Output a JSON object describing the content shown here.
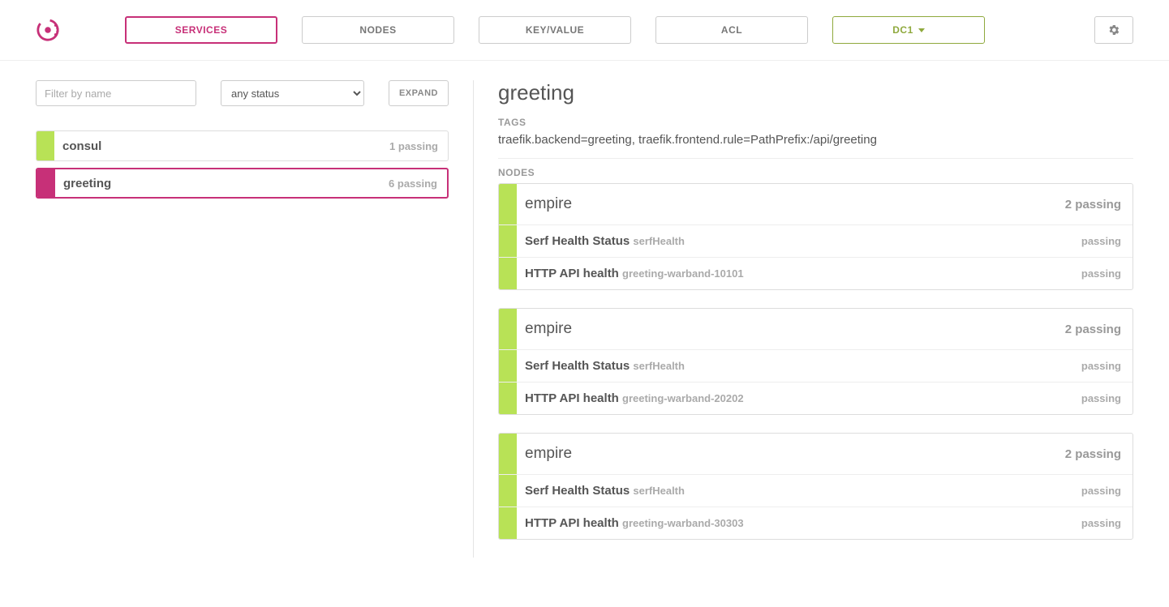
{
  "nav": {
    "services": "SERVICES",
    "nodes": "NODES",
    "kv": "KEY/VALUE",
    "acl": "ACL",
    "dc": "DC1"
  },
  "left": {
    "filter_placeholder": "Filter by name",
    "status_option": "any status",
    "expand": "EXPAND",
    "services": [
      {
        "name": "consul",
        "count": "1 passing",
        "selected": false
      },
      {
        "name": "greeting",
        "count": "6 passing",
        "selected": true
      }
    ]
  },
  "right": {
    "title": "greeting",
    "tags_label": "TAGS",
    "tags_value": "traefik.backend=greeting, traefik.frontend.rule=PathPrefix:/api/greeting",
    "nodes_label": "NODES",
    "nodes": [
      {
        "name": "empire",
        "count": "2 passing",
        "checks": [
          {
            "label": "Serf Health Status",
            "sub": "serfHealth",
            "result": "passing"
          },
          {
            "label": "HTTP API health",
            "sub": "greeting-warband-10101",
            "result": "passing"
          }
        ]
      },
      {
        "name": "empire",
        "count": "2 passing",
        "checks": [
          {
            "label": "Serf Health Status",
            "sub": "serfHealth",
            "result": "passing"
          },
          {
            "label": "HTTP API health",
            "sub": "greeting-warband-20202",
            "result": "passing"
          }
        ]
      },
      {
        "name": "empire",
        "count": "2 passing",
        "checks": [
          {
            "label": "Serf Health Status",
            "sub": "serfHealth",
            "result": "passing"
          },
          {
            "label": "HTTP API health",
            "sub": "greeting-warband-30303",
            "result": "passing"
          }
        ]
      }
    ]
  }
}
